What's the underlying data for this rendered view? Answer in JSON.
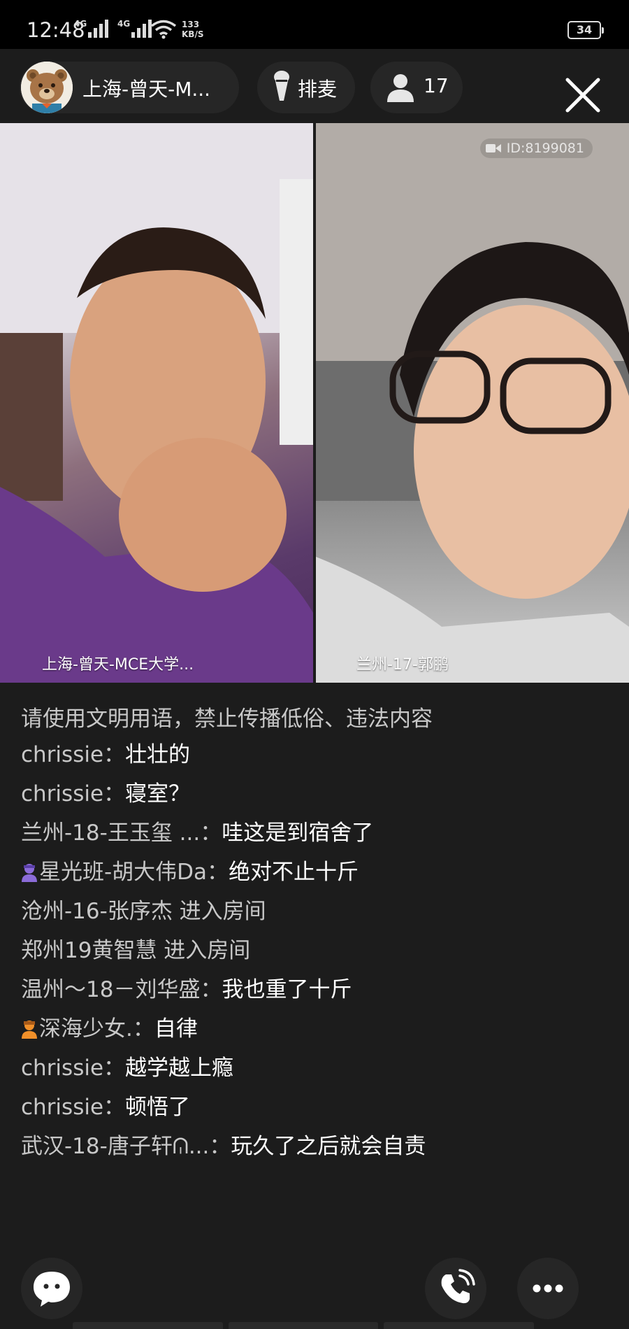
{
  "status_bar": {
    "time": "12:48",
    "network_1": "4G",
    "network_2": "4G",
    "speed_value": "133",
    "speed_unit": "KB/S",
    "battery": "34"
  },
  "header": {
    "host_name": "上海-曾天-M...",
    "queue_label": "排麦",
    "viewer_count": "17"
  },
  "videos": {
    "left_label": "上海-曾天-MCE大学...",
    "right_label": "兰州-17-郭鹏",
    "room_id": "ID:8199081"
  },
  "chat": {
    "system_notice": "请使用文明用语，禁止传播低俗、违法内容",
    "messages": [
      {
        "name": "chrissie：",
        "text": "壮壮的"
      },
      {
        "name": "chrissie：",
        "text": "寝室？"
      },
      {
        "name": "兰州-18-王玉玺 ...：",
        "text": "哇这是到宿舍了"
      },
      {
        "name": "星光班-胡大伟Da：",
        "text": "绝对不止十斤",
        "badge": "purple"
      },
      {
        "enter": "沧州-16-张序杰 进入房间"
      },
      {
        "enter": "郑州19黄智慧 进入房间"
      },
      {
        "name": "温州～18－刘华盛：",
        "text": "我也重了十斤"
      },
      {
        "name": "深海少女.：",
        "text": "自律",
        "badge": "orange"
      },
      {
        "name": "chrissie：",
        "text": "越学越上瘾"
      },
      {
        "name": "chrissie：",
        "text": "顿悟了"
      },
      {
        "name": "武汉-18-唐子轩ᕬ...：",
        "text": "玩久了之后就会自责"
      }
    ]
  },
  "colors": {
    "background": "#1c1c1c",
    "pill": "#262626",
    "name_text": "#c8c8c8",
    "badge_purple": "#8b6bd8",
    "badge_orange": "#f0902a"
  },
  "icons": {
    "queue": "microphone-icon",
    "viewers": "person-icon",
    "close": "close-icon",
    "chat": "chat-bubble-icon",
    "call": "phone-call-icon",
    "more": "more-icon"
  }
}
